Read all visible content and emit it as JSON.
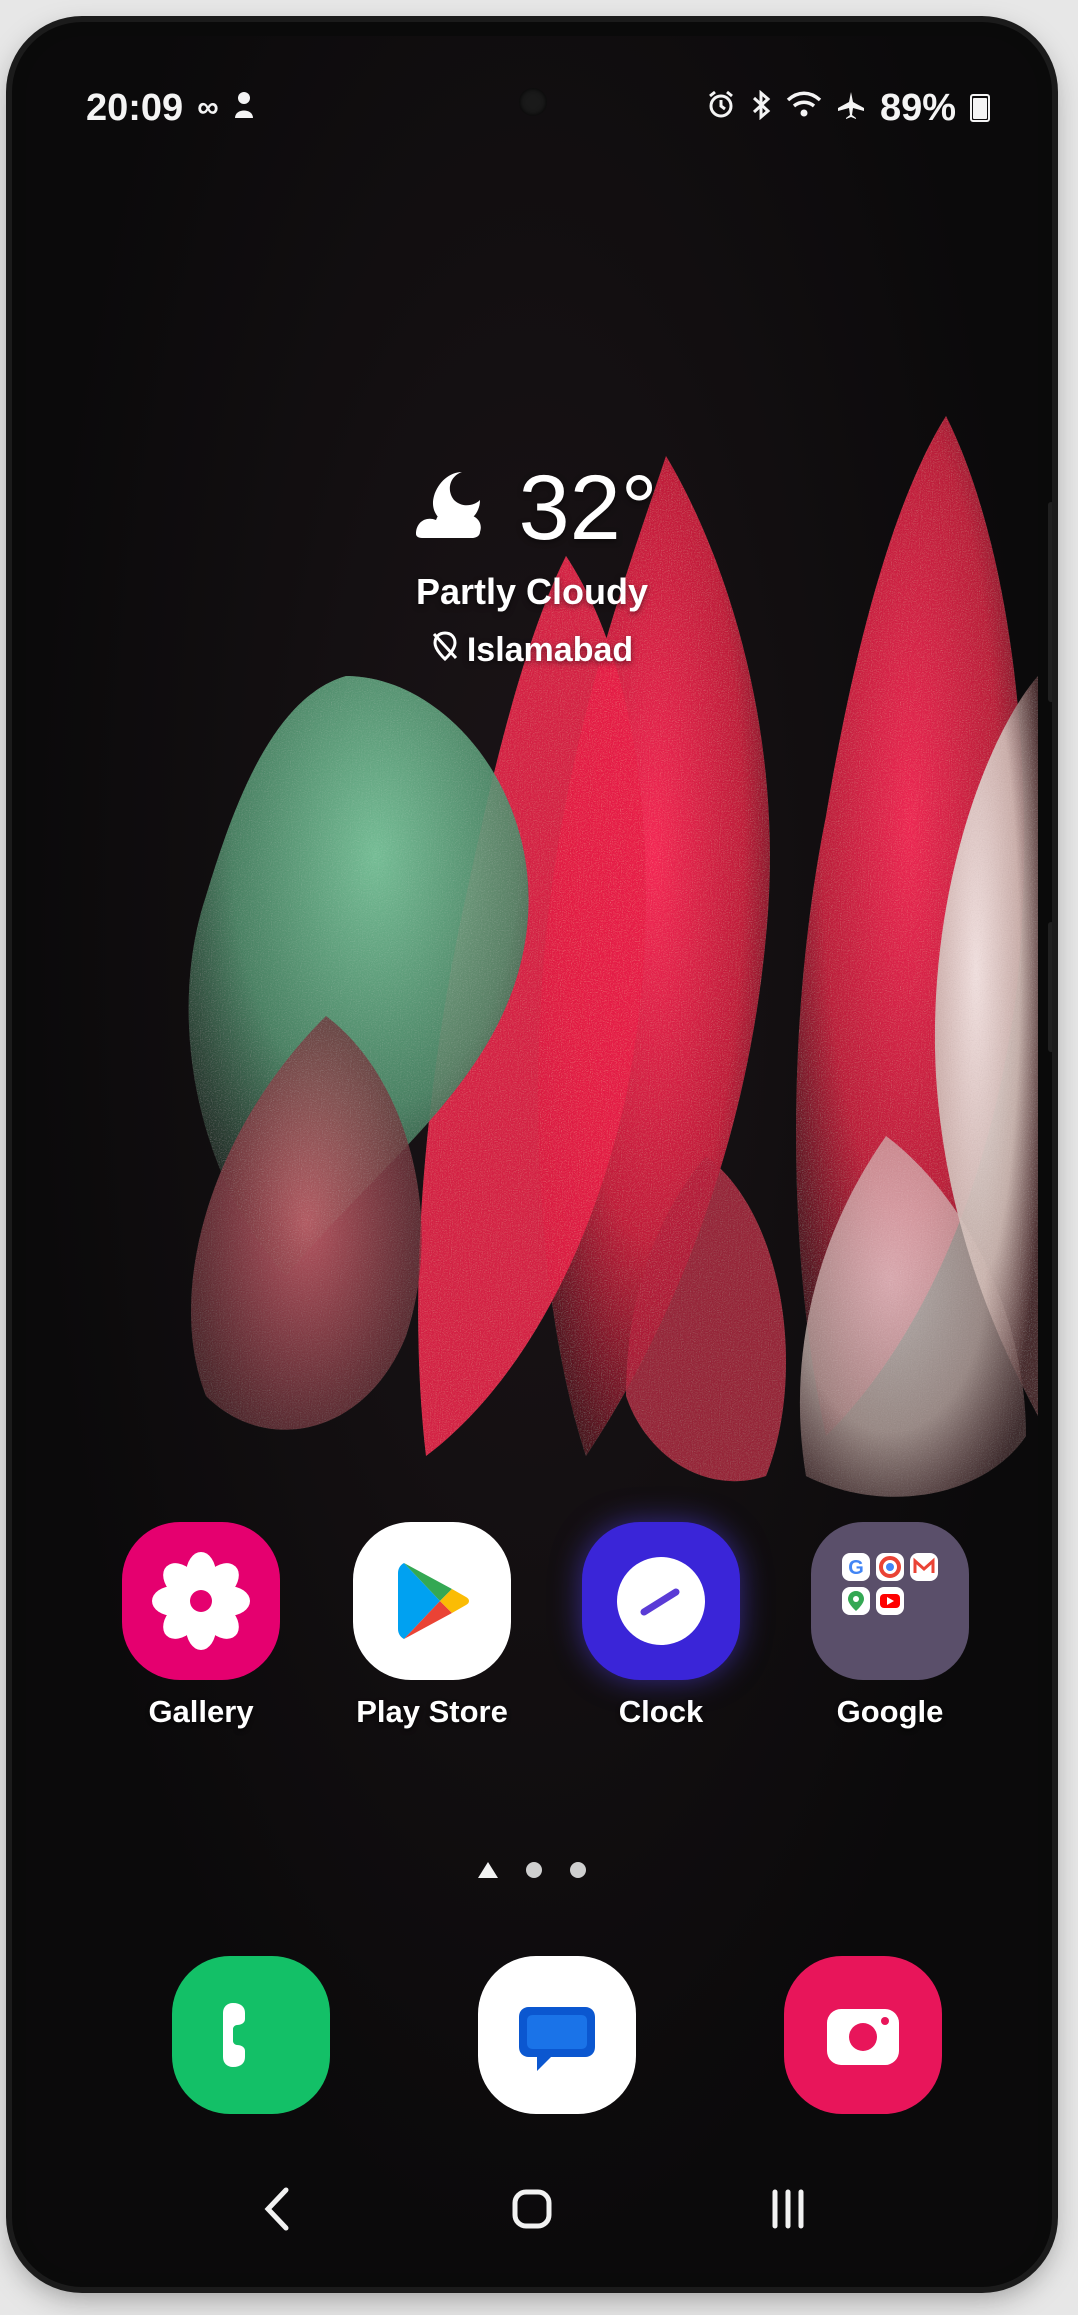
{
  "status_bar": {
    "time": "20:09",
    "battery": "89%",
    "left_icons": [
      "infinity-icon",
      "person-icon"
    ],
    "right_icons": [
      "alarm-icon",
      "bluetooth-icon",
      "wifi-icon",
      "airplane-icon",
      "battery-icon"
    ]
  },
  "weather": {
    "temperature": "32°",
    "condition": "Partly Cloudy",
    "location": "Islamabad",
    "icon": "partly-cloudy-night-icon"
  },
  "apps": [
    {
      "label": "Gallery",
      "icon": "gallery-icon",
      "color": "#e5006f"
    },
    {
      "label": "Play Store",
      "icon": "play-store-icon",
      "color": "#ffffff"
    },
    {
      "label": "Clock",
      "icon": "clock-icon",
      "color": "#3a25d8"
    },
    {
      "label": "Google",
      "icon": "google-folder-icon",
      "color": "#5a4f6a"
    }
  ],
  "page_indicator": {
    "pages": 3,
    "current": 1
  },
  "dock": [
    {
      "name": "Phone",
      "icon": "phone-icon",
      "color": "#13c067"
    },
    {
      "name": "Messages",
      "icon": "messages-icon",
      "color": "#ffffff"
    },
    {
      "name": "Camera",
      "icon": "camera-icon",
      "color": "#e8155a"
    }
  ],
  "nav": [
    "back-icon",
    "home-icon",
    "recents-icon"
  ]
}
